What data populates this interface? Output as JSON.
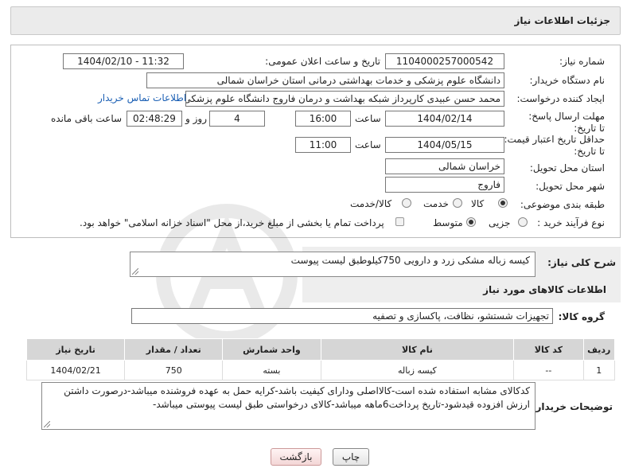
{
  "header": {
    "title": "جزئیات اطلاعات نیاز"
  },
  "form": {
    "need_number_label": "شماره نیاز:",
    "need_number": "1104000257000542",
    "announce_label": "تاریخ و ساعت اعلان عمومی:",
    "announce_value": "1404/02/10 - 11:32",
    "buyer_org_label": "نام دستگاه خریدار:",
    "buyer_org": "دانشگاه علوم پزشکی و خدمات بهداشتی درمانی استان خراسان شمالی",
    "creator_label": "ایجاد کننده درخواست:",
    "creator": "محمد حسن عبیدی کارپرداز شبکه بهداشت و درمان فاروج دانشگاه علوم پزشکی",
    "contact_link": "اطلاعات تماس خریدار",
    "reply_deadline_label": "مهلت ارسال پاسخ: تا تاریخ:",
    "reply_date": "1404/02/14",
    "time_label": "ساعت",
    "reply_time": "16:00",
    "days_value": "4",
    "days_label": "روز و",
    "remaining_time": "02:48:29",
    "remaining_label": "ساعت باقی مانده",
    "price_validity_label": "حداقل تاریخ اعتبار قیمت: تا تاریخ:",
    "validity_date": "1404/05/15",
    "validity_time": "11:00",
    "province_label": "استان محل تحویل:",
    "province": "خراسان شمالی",
    "city_label": "شهر محل تحویل:",
    "city": "فاروج",
    "category_label": "طبقه بندی موضوعی:",
    "category_options": [
      "کالا",
      "خدمت",
      "کالا/خدمت"
    ],
    "category_selected": "کالا",
    "process_label": "نوع فرآیند خرید :",
    "process_options": [
      "جزیی",
      "متوسط"
    ],
    "process_selected": "متوسط",
    "payment_note": "پرداخت تمام یا بخشی از مبلغ خرید،از محل \"اسناد خزانه اسلامی\" خواهد بود."
  },
  "description": {
    "label": "شرح کلی نیاز:",
    "text": "کیسه زباله مشکی زرد و دارویی 750کیلوطبق لیست پیوست"
  },
  "goods": {
    "section_title": "اطلاعات کالاهای مورد نیاز",
    "group_label": "گروه کالا:",
    "group_value": "تجهیزات شستشو، نظافت، پاکسازی و تصفیه",
    "columns": [
      "ردیف",
      "کد کالا",
      "نام کالا",
      "واحد شمارش",
      "تعداد / مقدار",
      "تاریخ نیاز"
    ],
    "rows": [
      {
        "index": "1",
        "code": "--",
        "name": "کیسه زباله",
        "unit": "بسته",
        "qty": "750",
        "date": "1404/02/21"
      }
    ]
  },
  "buyer_notes": {
    "label": "توضیحات خریدار:",
    "text": "کدکالای مشابه استفاده شده است-کالااصلی ودارای کیفیت باشد-کرایه حمل به عهده فروشنده میباشد-درصورت داشتن ارزش افزوده قیدشود-تاریخ پرداخت6ماهه میباشد-کالای درخواستی طبق لیست پیوستی میباشد-"
  },
  "buttons": {
    "print": "چاپ",
    "back": "بازگشت"
  },
  "colors": {
    "link": "#1a5fb4",
    "header_bg": "#ebebeb",
    "table_header": "#d6d6d6"
  }
}
